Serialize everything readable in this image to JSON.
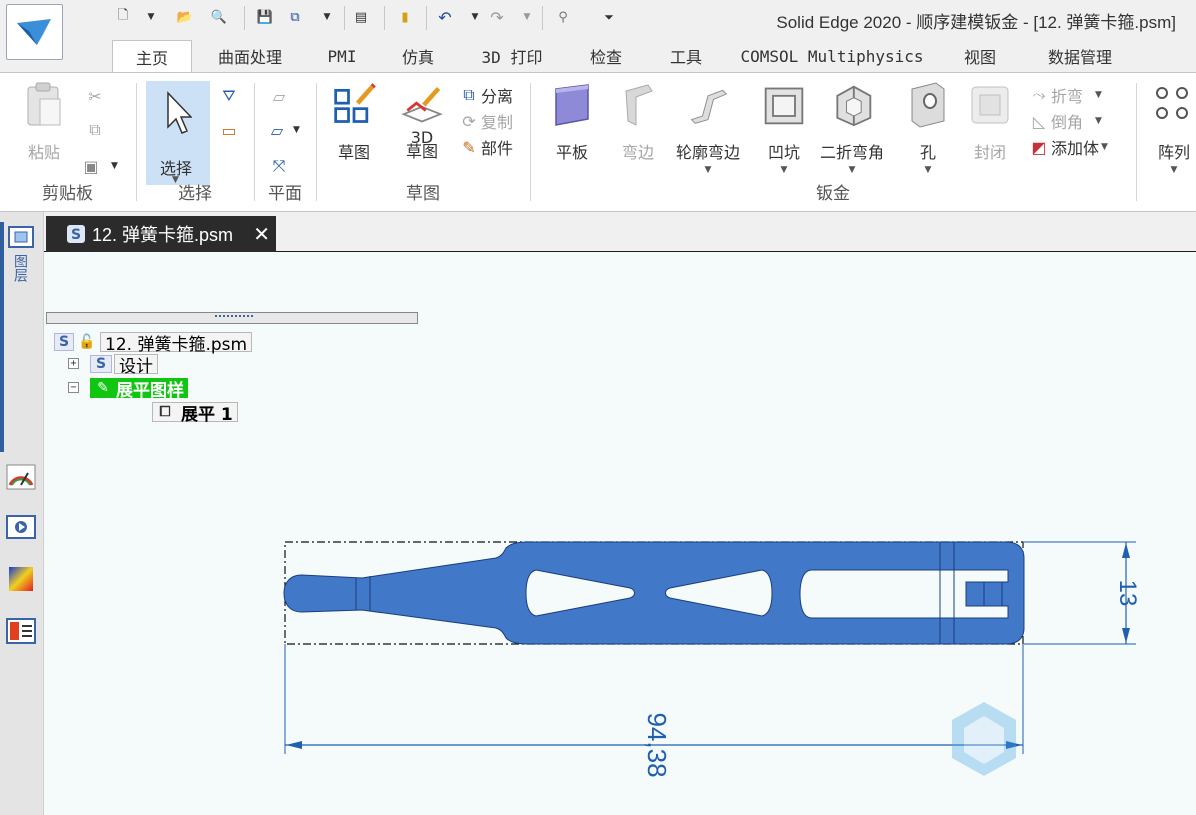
{
  "window": {
    "title": "Solid Edge 2020 - 顺序建模钣金 - [12. 弹簧卡箍.psm]"
  },
  "ribbon_tabs": [
    "主页",
    "曲面处理",
    "PMI",
    "仿真",
    "3D 打印",
    "检查",
    "工具",
    "COMSOL Multiphysics",
    "视图",
    "数据管理"
  ],
  "ribbon": {
    "clipboard": {
      "paste": "粘贴",
      "group": "剪贴板"
    },
    "select": {
      "select": "选择",
      "group": "选择"
    },
    "plane": {
      "group": "平面"
    },
    "sketch": {
      "sketch": "草图",
      "sketch3d": "3D\n草图",
      "sketch3d_a": "3D",
      "sketch3d_b": "草图",
      "group": "草图",
      "separate": "分离",
      "copy": "复制",
      "part": "部件"
    },
    "sheetmetal": {
      "tab": "平板",
      "flange": "弯边",
      "contour_flange": "轮廓弯边",
      "dimple": "凹坑",
      "jog": "二折弯角",
      "hole": "孔",
      "close": "封闭",
      "bend": "折弯",
      "chamfer": "倒角",
      "add_body": "添加体",
      "group": "钣金"
    },
    "pattern": {
      "pattern": "阵列"
    }
  },
  "left_panel": {
    "layer_label": "图层"
  },
  "document_tab": {
    "label": "12. 弹簧卡箍.psm"
  },
  "tree": {
    "root": "12. 弹簧卡箍.psm",
    "design": "设计",
    "flat_pattern": "展平图样",
    "flat_item": "展平 1"
  },
  "dimensions": {
    "height": "13",
    "length": "94,38"
  },
  "colors": {
    "part_fill": "#4178c8",
    "dimension": "#1f5fb0",
    "flat_highlight": "#11c611"
  }
}
